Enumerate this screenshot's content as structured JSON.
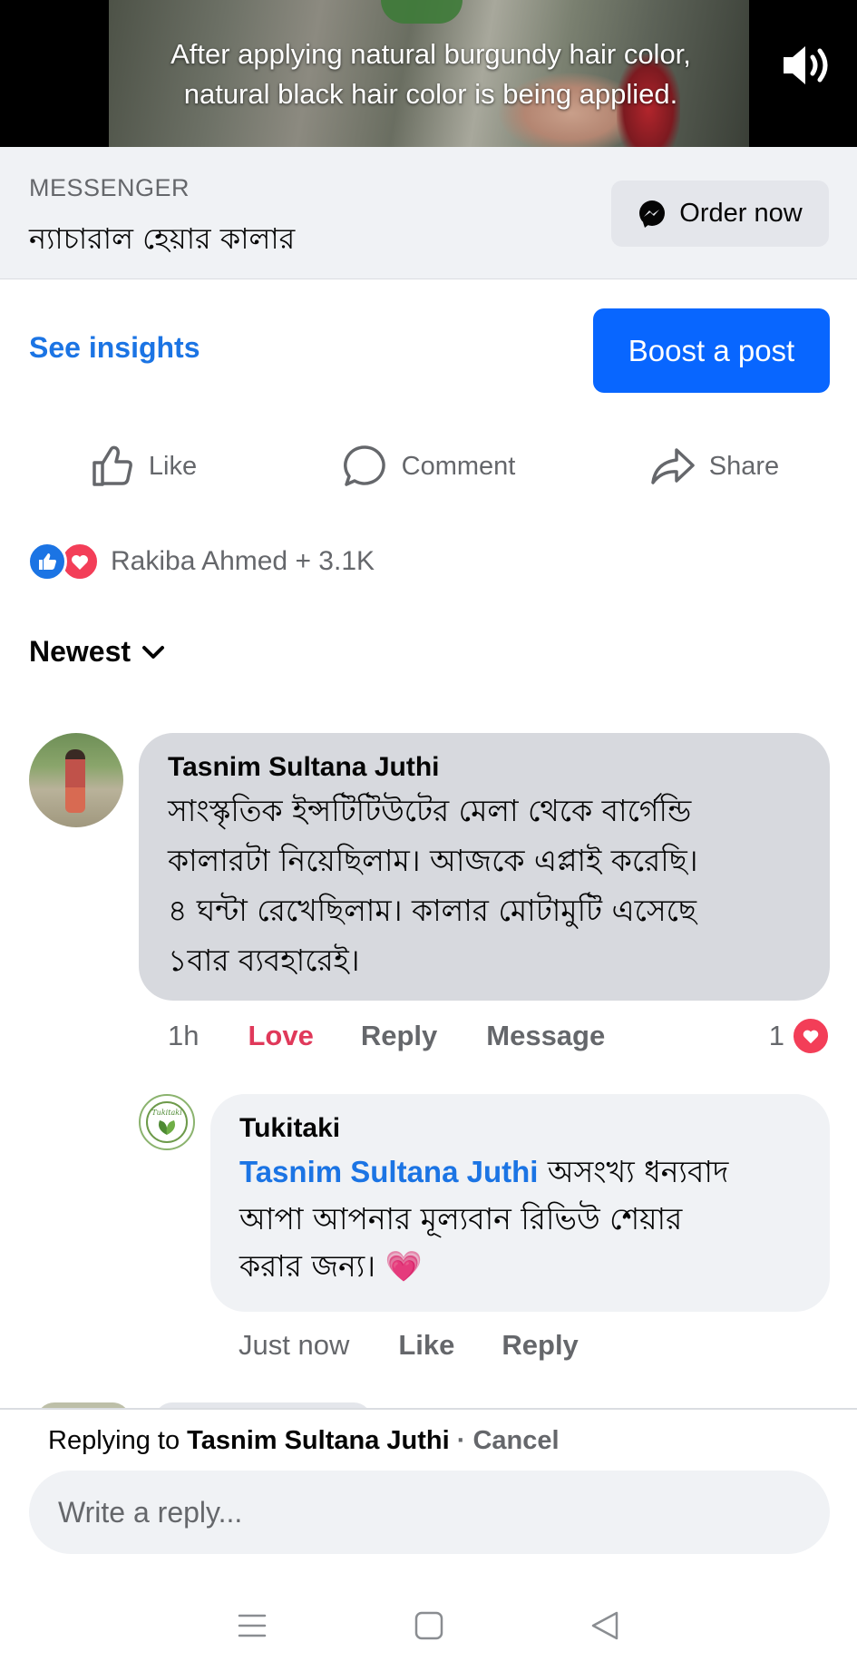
{
  "video": {
    "caption_line1": "After applying natural burgundy hair color,",
    "caption_line2": "natural black hair color is being applied.",
    "sound_icon": "volume-icon"
  },
  "messenger": {
    "label": "MESSENGER",
    "title": "ন্যাচারাল হেয়ার কালার",
    "button_label": "Order now",
    "button_icon": "messenger-icon"
  },
  "promo": {
    "insights_label": "See insights",
    "boost_label": "Boost a post"
  },
  "actions": {
    "like": "Like",
    "comment": "Comment",
    "share": "Share"
  },
  "reactions": {
    "summary": "Rakiba Ahmed + 3.1K",
    "colors": {
      "like": "#1b74e4",
      "love": "#f33e58"
    }
  },
  "sort": {
    "label": "Newest"
  },
  "comment": {
    "author": "Tasnim Sultana Juthi",
    "lines": [
      "সাংস্কৃতিক ইন্সটিটিউটের মেলা থেকে বার্গেন্ডি",
      "কালারটা নিয়েছিলাম। আজকে এপ্লাই করেছি।",
      "৪ ঘন্টা রেখেছিলাম। কালার মোটামুটি এসেছে",
      "১বার ব্যবহারেই।"
    ],
    "time": "1h",
    "love_label": "Love",
    "reply_label": "Reply",
    "message_label": "Message",
    "reaction_count": "1"
  },
  "reply": {
    "author": "Tukitaki",
    "avatar_text": "Tukitaki",
    "mention": "Tasnim Sultana Juthi",
    "text_after_mention": " অসংখ্য ধন্যবাদ",
    "lines": [
      "আপা আপনার মূল্যবান রিভিউ শেয়ার",
      "করার জন্য।"
    ],
    "emoji": "💗",
    "time": "Just now",
    "like_label": "Like",
    "reply_label": "Reply"
  },
  "composer": {
    "replying_prefix": "Replying to ",
    "replying_name": "Tasnim Sultana Juthi",
    "separator": " · ",
    "cancel_label": "Cancel",
    "placeholder": "Write a reply..."
  },
  "navbar": {
    "icons": [
      "menu-icon",
      "home-square-icon",
      "back-triangle-icon"
    ]
  }
}
